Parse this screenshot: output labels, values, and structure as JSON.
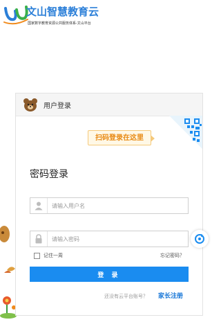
{
  "header": {
    "logo_title": "文山智慧教育云",
    "logo_subtitle": "国家数字教育资源公共服务体系-文山平台"
  },
  "login": {
    "tab_title": "用户登录",
    "scan_tip": "扫码登录在这里",
    "form_title": "密码登录",
    "username_placeholder": "请输入用户名",
    "password_placeholder": "请输入密码",
    "remember_label": "记住一周",
    "forgot_label": "忘记密码？",
    "login_button": "登 录",
    "no_account_text": "还没有云平台账号？",
    "parent_register": "家长注册"
  },
  "colors": {
    "primary_button": "#1a8cf0",
    "register_link": "#1a78d8",
    "scan_tip_text": "#e88a14",
    "logo_title": "#2b7fd8"
  },
  "icons": {
    "logo": "wenshan-logo-icon",
    "bear": "bear-avatar-icon",
    "user": "user-icon",
    "lock": "lock-icon",
    "qr": "qr-code-icon",
    "float": "refresh-float-icon"
  }
}
